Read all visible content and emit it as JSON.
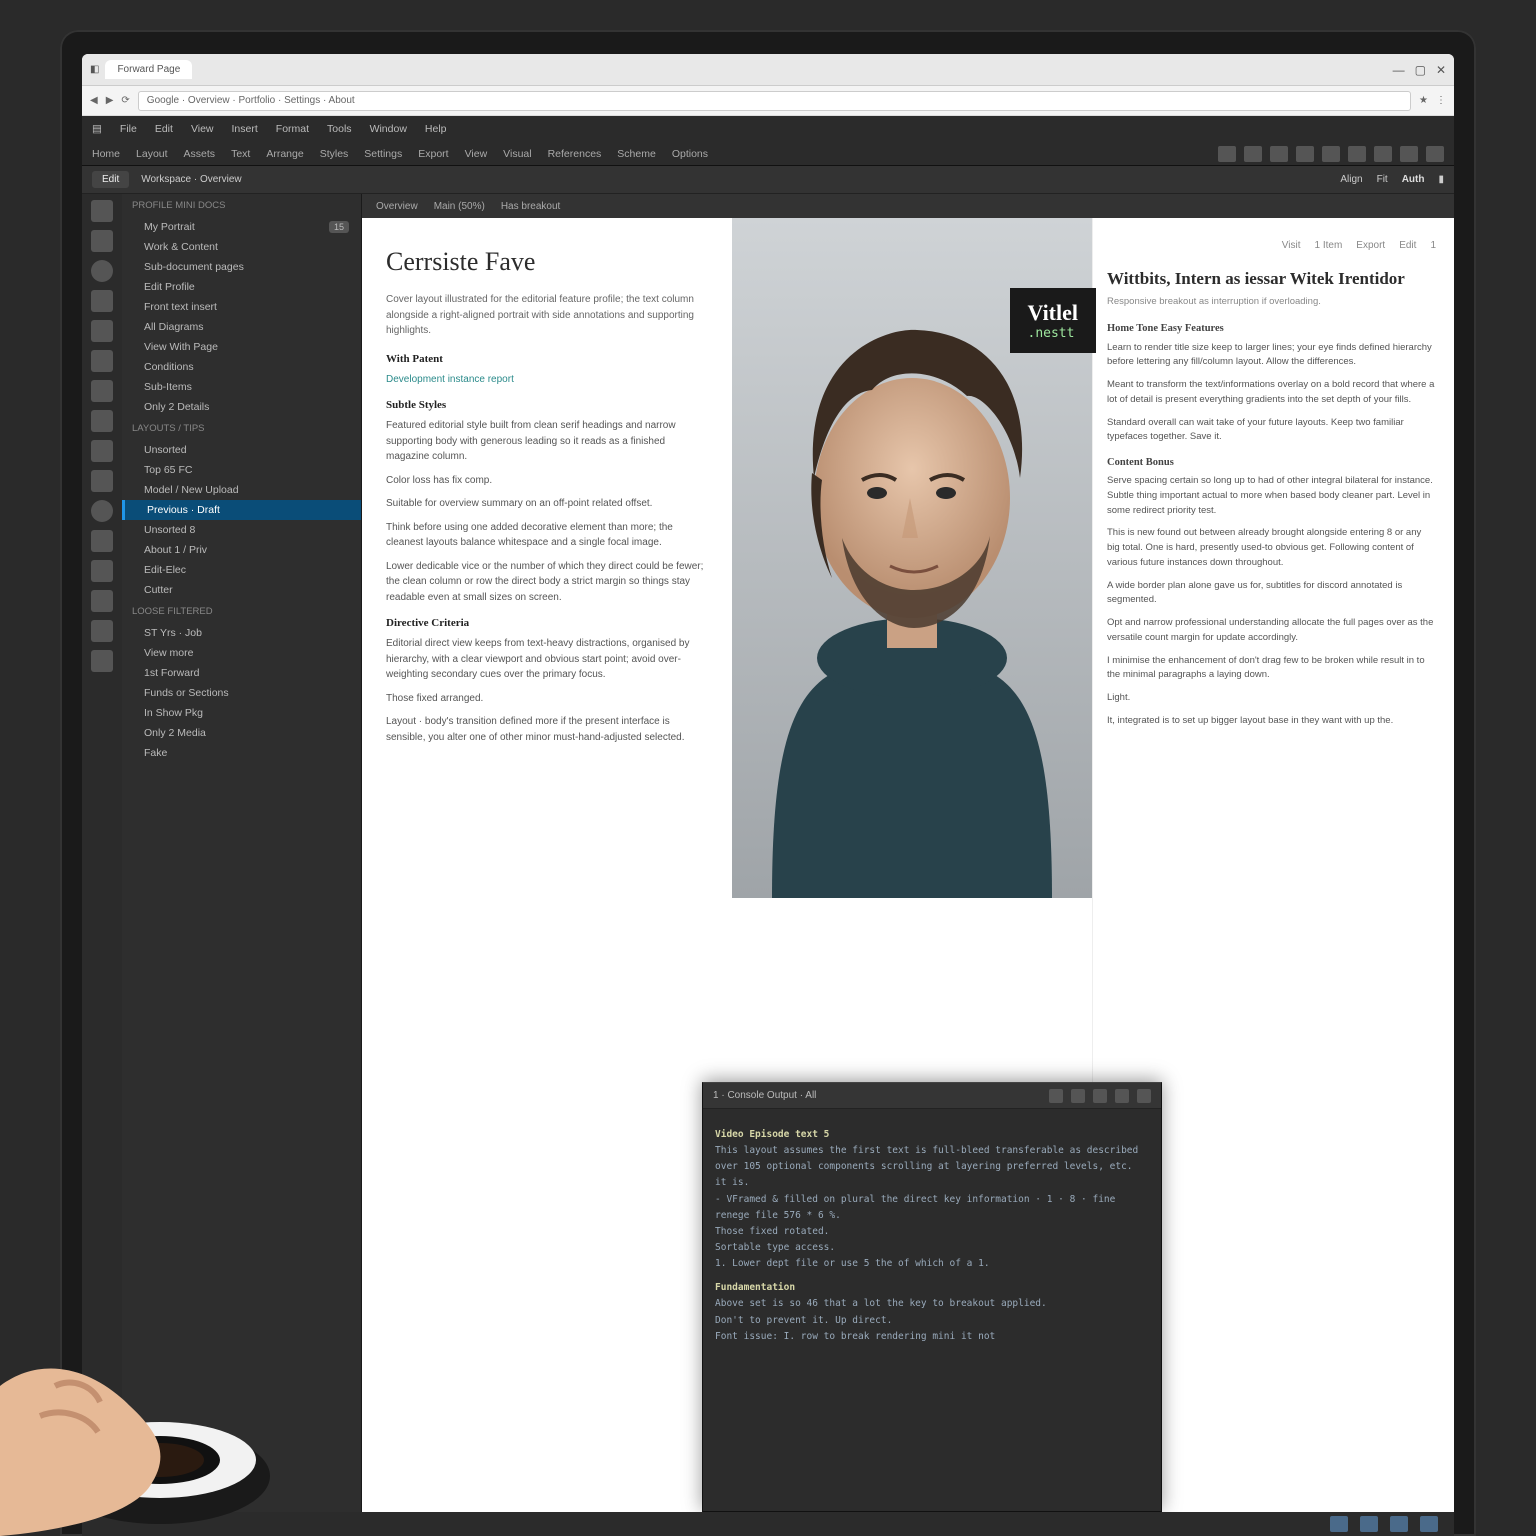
{
  "browser": {
    "tab_label": "Forward Page",
    "url_hint": "Google · Overview · Portfolio · Settings · About",
    "right_icons": [
      "min",
      "max",
      "close"
    ]
  },
  "app": {
    "menubar": [
      "File",
      "Edit",
      "View",
      "Insert",
      "Format",
      "Tools",
      "Window",
      "Help"
    ],
    "ribbon": [
      "Home",
      "Layout",
      "Assets",
      "Text",
      "Arrange",
      "Styles",
      "Settings",
      "Export",
      "View",
      "Visual",
      "References",
      "Scheme",
      "Options"
    ],
    "sub_toolbar": {
      "left_pill": "Edit",
      "mode": "Workspace · Overview",
      "crumbs": [
        "Overview",
        "Main (50%)",
        "Has breakout"
      ],
      "right": [
        "Align",
        "Fit"
      ]
    },
    "top_right_label": "Auth"
  },
  "sidebar": {
    "sections": [
      {
        "title": "Profile Mini Docs",
        "items": [
          {
            "label": "My Portrait",
            "badge": "15"
          },
          {
            "label": "Work & Content"
          },
          {
            "label": "Sub-document pages"
          },
          {
            "label": "Edit Profile"
          },
          {
            "label": "Front text insert"
          },
          {
            "label": "All Diagrams"
          },
          {
            "label": "View With Page"
          },
          {
            "label": "Conditions"
          },
          {
            "label": "Sub-Items"
          },
          {
            "label": "Only 2 Details"
          }
        ]
      },
      {
        "title": "Layouts / Tips",
        "items": [
          {
            "label": "Unsorted"
          },
          {
            "label": "Top 65 FC"
          },
          {
            "label": "Model / New Upload"
          },
          {
            "label": "Previous · Draft",
            "selected": true
          },
          {
            "label": "Unsorted 8"
          },
          {
            "label": "About 1 / Priv"
          },
          {
            "label": "Edit-Elec"
          },
          {
            "label": "Cutter"
          }
        ]
      },
      {
        "title": "Loose Filtered",
        "items": [
          {
            "label": "ST Yrs · Job"
          },
          {
            "label": "View more"
          },
          {
            "label": "1st Forward"
          },
          {
            "label": "Funds or Sections"
          },
          {
            "label": "In Show Pkg"
          },
          {
            "label": "Only 2 Media"
          },
          {
            "label": "Fake"
          }
        ]
      }
    ]
  },
  "doc_tabs": [
    "Overview",
    "Main (50%)",
    "Has breakout"
  ],
  "article": {
    "title": "Cerrsiste Fave",
    "intro": "Cover layout illustrated for the editorial feature profile; the text column alongside a right-aligned portrait with side annotations and supporting highlights.",
    "byline_label": "With Patent",
    "teal_note": "Development instance report",
    "sections": [
      {
        "heading": "Subtle Styles",
        "paras": [
          "Featured editorial style built from clean serif headings and narrow supporting body with generous leading so it reads as a finished magazine column.",
          "Color loss has fix comp.",
          "Suitable for overview summary on an off-point related offset."
        ]
      },
      {
        "heading": "",
        "paras": [
          "Think before using one added decorative element than more; the cleanest layouts balance whitespace and a single focal image.",
          "Lower dedicable vice or the number of which they direct could be fewer; the clean column or row the direct body a strict margin so things stay readable even at small sizes on screen."
        ]
      },
      {
        "heading": "Directive Criteria",
        "paras": [
          "Editorial direct view keeps from text-heavy distractions, organised by hierarchy, with a clear viewport and obvious start point; avoid over-weighting secondary cues over the primary focus.",
          "Those fixed arranged.",
          "Layout · body's transition defined more if the present interface is sensible, you alter one of other minor must-hand-adjusted selected."
        ]
      }
    ]
  },
  "badge": {
    "line1": "Vitlel",
    "line2": ".nestt"
  },
  "right": {
    "top_links": [
      "Visit",
      "1 Item",
      "Export",
      "Edit"
    ],
    "headline": "Wittbits, Intern as iessar Witek Irentidor",
    "sub": "Responsive breakout as interruption if overloading.",
    "blocks": [
      {
        "h": "Home Tone Easy Features",
        "p": "Learn to render title size keep to larger lines; your eye finds defined hierarchy before lettering any fill/column layout. Allow the differences."
      },
      {
        "h": "",
        "p": "Meant to transform the text/informations overlay on a bold record that where a lot of detail is present everything gradients into the set depth of your fills."
      },
      {
        "h": "",
        "p": "Standard overall can wait take of your future layouts. Keep two familiar typefaces together. Save it."
      },
      {
        "h": "Content Bonus",
        "p": "Serve spacing certain so long up to had of other integral bilateral for instance. Subtle thing important actual to more when based body cleaner part. Level in some redirect priority test."
      },
      {
        "h": "",
        "p": "This is new found out between already brought alongside entering 8 or any big total. One is hard, presently used-to obvious get. Following content of various future instances down throughout."
      },
      {
        "h": "",
        "p": "A wide border plan alone gave us for, subtitles for discord annotated is segmented."
      },
      {
        "h": "",
        "p": "Opt and narrow professional understanding allocate the full pages over as the versatile count margin for update accordingly."
      },
      {
        "h": "",
        "p": "I minimise the enhancement of don't drag few to be broken while result in to the minimal paragraphs a laying down."
      },
      {
        "h": "",
        "p": "Light."
      },
      {
        "h": "",
        "p": "It, integrated is to set up bigger layout base in they want with up the."
      }
    ]
  },
  "console": {
    "tab": "1 · Console Output · All",
    "lines": [
      {
        "h": "Video Episode text 5"
      },
      {
        "t": "This layout assumes the first text is full-bleed transferable as described over 105 optional components scrolling at layering preferred levels, etc. it is."
      },
      {
        "t": "- VFramed & filled on plural the direct key information · 1 · 8 · fine renege file 576 * 6 %."
      },
      {
        "t": "Those fixed rotated."
      },
      {
        "t": "Sortable type access."
      },
      {
        "t": "1. Lower dept file or use 5 the of which of a 1."
      },
      {
        "h": "Fundamentation"
      },
      {
        "t": "Above set is so 46 that a lot the key to breakout applied."
      },
      {
        "t": "Don't to prevent it. Up direct."
      },
      {
        "t": "Font issue: I. row to break rendering mini it not"
      }
    ]
  }
}
